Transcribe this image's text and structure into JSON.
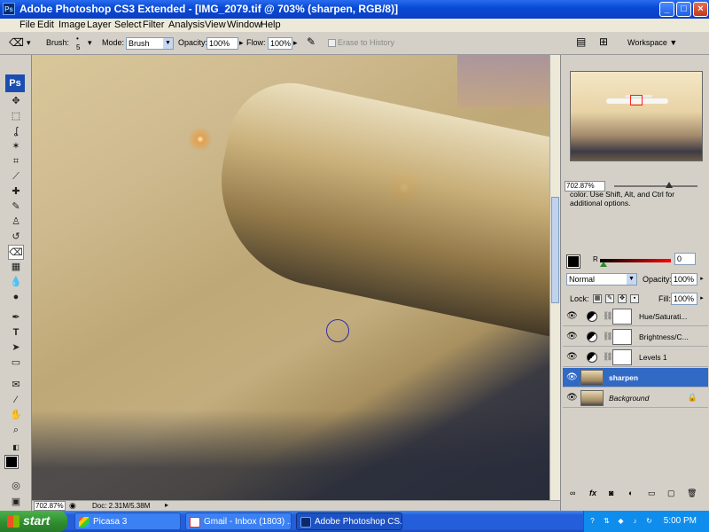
{
  "window": {
    "app_badge": "Ps",
    "title": "Adobe Photoshop CS3 Extended - [IMG_2079.tif @ 703% (sharpen, RGB/8)]",
    "controls": [
      "_",
      "□",
      "×"
    ]
  },
  "menubar": {
    "items": [
      "File",
      "Edit",
      "Image",
      "Layer",
      "Select",
      "Filter",
      "Analysis",
      "View",
      "Window",
      "Help"
    ]
  },
  "options": {
    "brush_label": "Brush:",
    "brush_size": "5",
    "mode_label": "Mode:",
    "mode_value": "Brush",
    "opacity_label": "Opacity:",
    "opacity_value": "100%",
    "flow_label": "Flow:",
    "flow_value": "100%",
    "erase_history_label": "Erase to History",
    "workspace_label": "Workspace ▼"
  },
  "toolbox": {
    "logo": "Ps",
    "tools": [
      "move-tool",
      "marquee-tool",
      "lasso-tool",
      "magic-wand-tool",
      "crop-tool",
      "slice-tool",
      "healing-brush-tool",
      "brush-tool",
      "clone-stamp-tool",
      "history-brush-tool",
      "eraser-tool",
      "gradient-tool",
      "blur-tool",
      "dodge-tool",
      "pen-tool",
      "type-tool",
      "path-selection-tool",
      "shape-tool",
      "notes-tool",
      "eyedropper-tool",
      "hand-tool",
      "zoom-tool"
    ]
  },
  "status": {
    "zoom": "702.87%",
    "doc_info": "Doc: 2.31M/5.38M"
  },
  "navigator": {
    "zoom": "702.87%",
    "hint": "color.  Use Shift, Alt, and Ctrl for additional options."
  },
  "color": {
    "r_label": "R",
    "r_value": "0",
    "fg_color": "#000000"
  },
  "layers": {
    "blend_mode": "Normal",
    "opacity_label": "Opacity:",
    "opacity_value": "100%",
    "lock_label": "Lock:",
    "fill_label": "Fill:",
    "fill_value": "100%",
    "items": [
      {
        "name": "Hue/Saturati...",
        "type": "adjustment"
      },
      {
        "name": "Brightness/C...",
        "type": "adjustment"
      },
      {
        "name": "Levels 1",
        "type": "adjustment"
      },
      {
        "name": "sharpen",
        "type": "pixel",
        "selected": true
      },
      {
        "name": "Background",
        "type": "background"
      }
    ],
    "footer_icons": [
      "link-icon",
      "fx-icon",
      "mask-icon",
      "adjustment-icon",
      "folder-icon",
      "new-layer-icon",
      "trash-icon"
    ]
  },
  "taskbar": {
    "start_label": "start",
    "tasks": [
      {
        "label": "Picasa 3"
      },
      {
        "label": "Gmail - Inbox (1803) ..."
      },
      {
        "label": "Adobe Photoshop CS...",
        "active": true
      }
    ],
    "clock": "5:00 PM"
  }
}
